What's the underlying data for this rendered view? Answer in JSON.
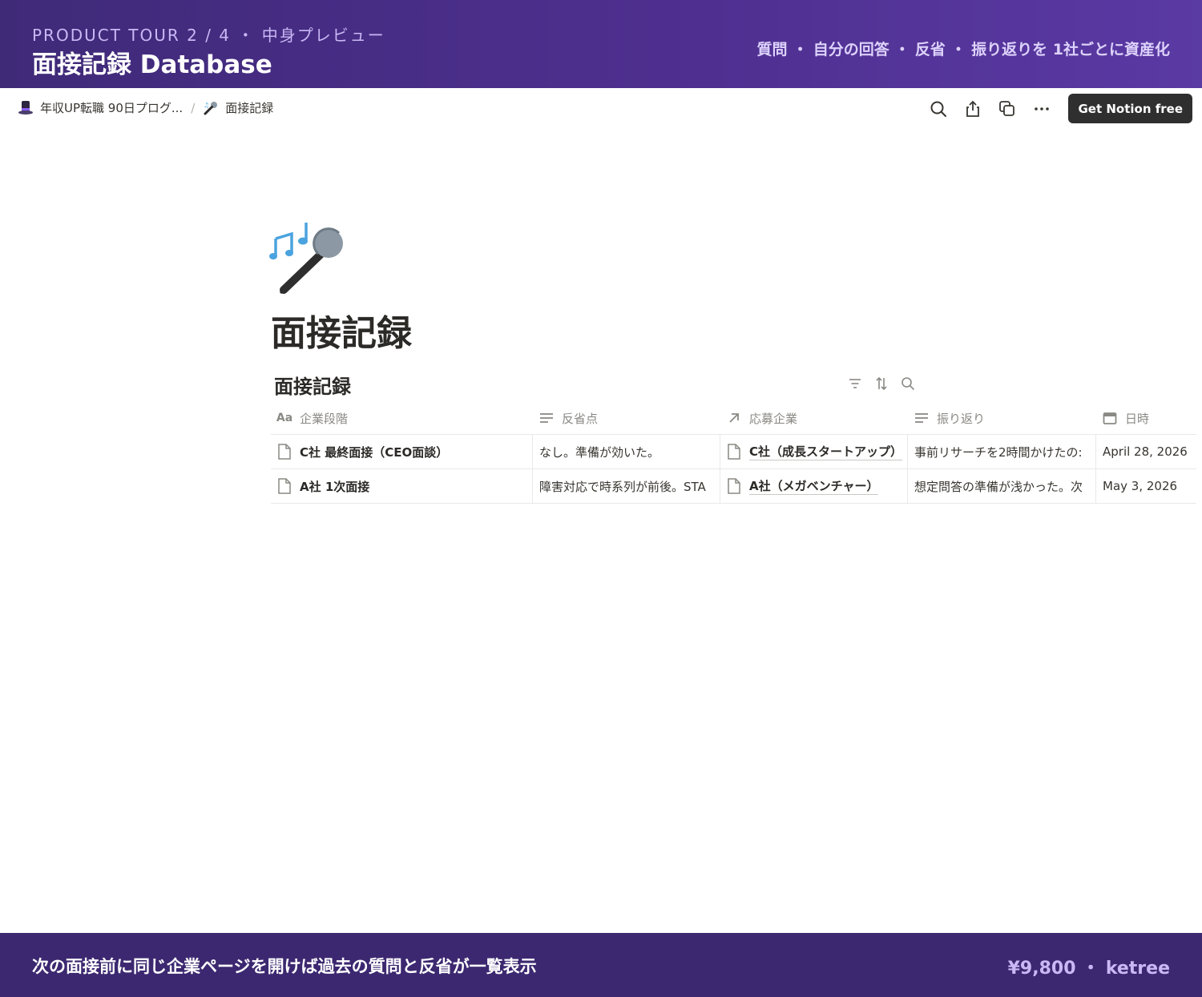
{
  "banner": {
    "kicker": "PRODUCT TOUR 2 / 4 ・ 中身プレビュー",
    "title": "面接記録 Database",
    "tagline": "質問 ・ 自分の回答 ・ 反省 ・ 振り返りを 1社ごとに資産化"
  },
  "topbar": {
    "breadcrumb": [
      {
        "icon": "top-hat-icon",
        "label": "年収UP転職 90日プログ..."
      },
      {
        "icon": "microphone-icon",
        "label": "面接記録"
      }
    ],
    "separator": "/",
    "actions": [
      "search-icon",
      "share-icon",
      "duplicate-icon",
      "more-icon"
    ],
    "cta_label": "Get Notion free"
  },
  "page": {
    "icon": "microphone-music-icon",
    "title": "面接記録"
  },
  "database": {
    "title": "面接記録",
    "tools": [
      "filter-icon",
      "sort-icon",
      "search-icon"
    ],
    "columns": [
      {
        "icon": "title-aa-icon",
        "label": "企業段階"
      },
      {
        "icon": "text-lines-icon",
        "label": "反省点"
      },
      {
        "icon": "relation-arrow-icon",
        "label": "応募企業"
      },
      {
        "icon": "text-lines-icon",
        "label": "振り返り"
      },
      {
        "icon": "calendar-icon",
        "label": "日時"
      }
    ],
    "rows": [
      {
        "stage": "C社 最終面接（CEO面談）",
        "reflection_points": "なし。準備が効いた。",
        "company": "C社（成長スタートアップ）",
        "review": "事前リサーチを2時間かけたの:",
        "date": "April 28, 2026"
      },
      {
        "stage": "A社 1次面接",
        "reflection_points": "障害対応で時系列が前後。STA",
        "company": "A社（メガベンチャー）",
        "review": "想定問答の準備が浅かった。次",
        "date": "May 3, 2026"
      }
    ]
  },
  "footer": {
    "message": "次の面接前に同じ企業ページを開けば過去の質問と反省が一覧表示",
    "price": "¥9,800 ・ ketree"
  },
  "colors": {
    "banner_start": "#3f2a78",
    "banner_end": "#5a3aa3",
    "footer_bg": "#3c2870",
    "accent_text": "#c9b8f5",
    "cta_bg": "#2f2f2f"
  }
}
